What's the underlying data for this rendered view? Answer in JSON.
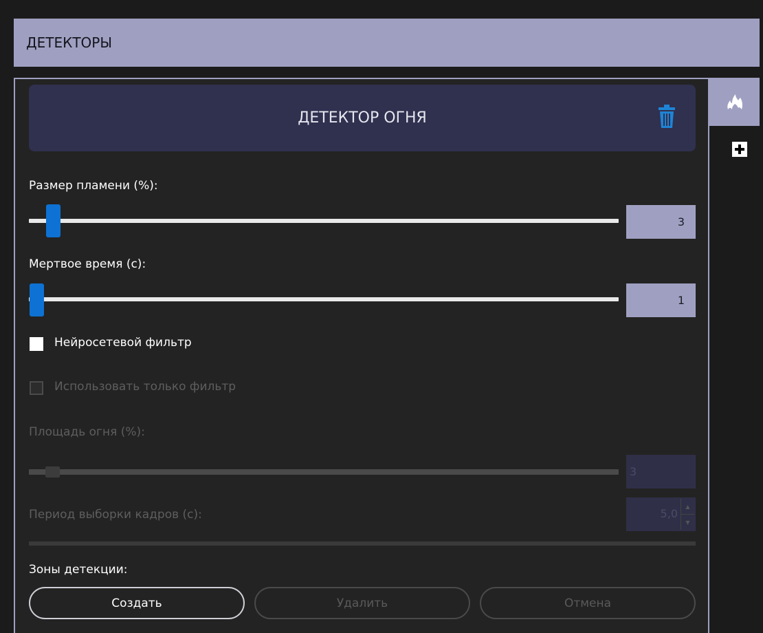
{
  "window": {
    "title": "ДЕТЕКТОРЫ"
  },
  "colors": {
    "accent": "#9fa0c1",
    "header_bg": "#30304f",
    "slider_handle": "#0d72d4",
    "trash": "#1e84d6"
  },
  "tabs": [
    {
      "icon": "fire-icon",
      "active": true
    },
    {
      "icon": "plus-icon",
      "active": false
    }
  ],
  "detector": {
    "title": "ДЕТЕКТОР ОГНЯ",
    "flame_size": {
      "label": "Размер пламени (%):",
      "value": "3"
    },
    "dead_time": {
      "label": "Мертвое время (c):",
      "value": "1"
    },
    "neural_filter": {
      "label": "Нейросетевой фильтр",
      "checked": true
    },
    "use_filter_only": {
      "label": "Использовать только фильтр",
      "checked": false,
      "enabled": false
    },
    "fire_area": {
      "label": "Площадь огня (%):",
      "value": "3",
      "enabled": false
    },
    "frame_period": {
      "label": "Период выборки кадров (c):",
      "value": "5,0",
      "enabled": false
    }
  },
  "zones": {
    "label": "Зоны детекции:",
    "create_label": "Создать",
    "delete_label": "Удалить",
    "cancel_label": "Отмена"
  }
}
